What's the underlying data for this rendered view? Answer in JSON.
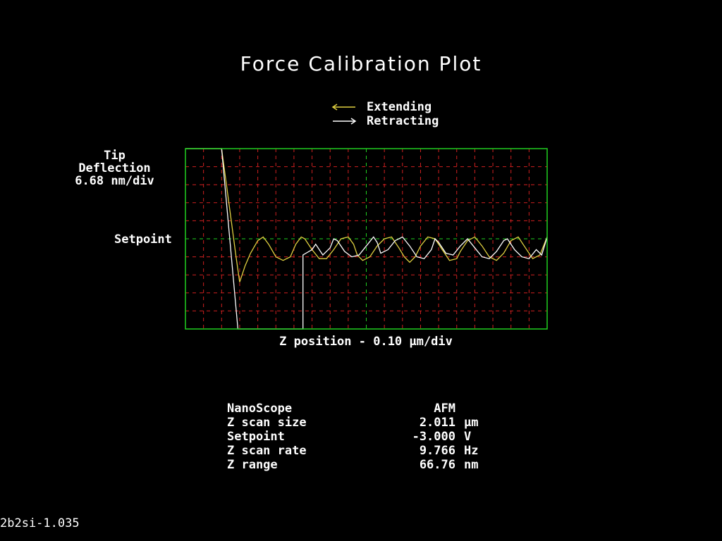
{
  "chart_data": {
    "type": "line",
    "title": "Force Calibration Plot",
    "xlabel": "Z position - 0.10 µm/div",
    "ylabel_lines": [
      "Tip",
      "Deflection",
      "6.68 nm/div"
    ],
    "setpoint_label": "Setpoint",
    "x_range": [
      0,
      2.0
    ],
    "y_range": [
      -5,
      5
    ],
    "x_divisions": 20,
    "y_divisions": 10,
    "grid": true,
    "colors": {
      "frame": "#20d020",
      "grid": "#d02020",
      "center": "#20d020",
      "extending": "#e0d040",
      "retracting": "#ffffff"
    },
    "legend": [
      {
        "label": "Extending",
        "arrow": "left",
        "color": "#e0d040"
      },
      {
        "label": "Retracting",
        "arrow": "right",
        "color": "#ffffff"
      }
    ],
    "series": [
      {
        "name": "Extending",
        "x": [
          0,
          0.2,
          0.24,
          0.28,
          0.3,
          0.31,
          0.33,
          0.36,
          0.4,
          0.43,
          0.46,
          0.5,
          0.54,
          0.58,
          0.61,
          0.64,
          0.66,
          0.7,
          0.74,
          0.78,
          0.82,
          0.86,
          0.9,
          0.93,
          0.95,
          0.98,
          1.02,
          1.06,
          1.1,
          1.14,
          1.18,
          1.21,
          1.24,
          1.27,
          1.3,
          1.34,
          1.38,
          1.42,
          1.46,
          1.5,
          1.52,
          1.56,
          1.6,
          1.64,
          1.68,
          1.72,
          1.76,
          1.8,
          1.84,
          1.88,
          1.92,
          1.96,
          2.0
        ],
        "y": [
          5,
          5,
          2.0,
          -1.0,
          -2.4,
          -2.1,
          -1.5,
          -0.8,
          -0.1,
          0.1,
          -0.3,
          -1.0,
          -1.2,
          -1.0,
          -0.3,
          0.1,
          0.0,
          -0.6,
          -1.1,
          -1.1,
          -0.6,
          0.0,
          0.1,
          -0.3,
          -0.9,
          -1.2,
          -1.0,
          -0.4,
          0.0,
          0.1,
          -0.5,
          -1.0,
          -1.3,
          -1.0,
          -0.4,
          0.1,
          0.0,
          -0.6,
          -1.2,
          -1.1,
          -0.7,
          -0.1,
          0.1,
          -0.4,
          -1.0,
          -1.2,
          -0.8,
          -0.1,
          0.1,
          -0.5,
          -1.1,
          -0.9,
          0.1
        ]
      },
      {
        "name": "Retracting",
        "x": [
          0,
          0.2,
          0.29,
          0.65,
          0.65,
          0.7,
          0.72,
          0.76,
          0.8,
          0.82,
          0.84,
          0.88,
          0.92,
          0.96,
          1.0,
          1.04,
          1.06,
          1.08,
          1.12,
          1.16,
          1.2,
          1.24,
          1.28,
          1.32,
          1.36,
          1.38,
          1.4,
          1.44,
          1.48,
          1.52,
          1.56,
          1.6,
          1.64,
          1.68,
          1.72,
          1.76,
          1.78,
          1.82,
          1.86,
          1.9,
          1.94,
          1.97,
          2.0
        ],
        "y": [
          5,
          5,
          -5,
          -5,
          -0.9,
          -0.6,
          -0.3,
          -0.9,
          -0.5,
          0.0,
          -0.1,
          -0.7,
          -1.0,
          -0.9,
          -0.4,
          0.1,
          -0.2,
          -0.8,
          -0.6,
          -0.1,
          0.1,
          -0.4,
          -1.0,
          -1.1,
          -0.6,
          0.0,
          -0.2,
          -0.8,
          -0.9,
          -0.4,
          0.0,
          -0.5,
          -1.0,
          -1.1,
          -0.7,
          -0.1,
          0.0,
          -0.6,
          -1.0,
          -1.1,
          -0.6,
          -0.9,
          0.1
        ]
      }
    ]
  },
  "info": {
    "rows": [
      {
        "name": "NanoScope",
        "value": "AFM",
        "unit": ""
      },
      {
        "name": "Z scan size",
        "value": "2.011",
        "unit": "µm"
      },
      {
        "name": "Setpoint",
        "value": "-3.000",
        "unit": "V"
      },
      {
        "name": "Z scan rate",
        "value": "9.766",
        "unit": "Hz"
      },
      {
        "name": "Z range",
        "value": "66.76",
        "unit": "nm"
      }
    ]
  },
  "footer": "2b2si-1.035"
}
